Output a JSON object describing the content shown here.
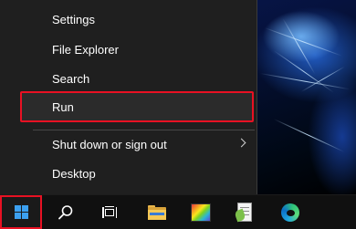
{
  "menu": {
    "items": [
      {
        "label": "Settings"
      },
      {
        "label": "File Explorer"
      },
      {
        "label": "Search"
      },
      {
        "label": "Run"
      },
      {
        "label": "Shut down or sign out"
      },
      {
        "label": "Desktop"
      }
    ],
    "highlighted_item": "Run",
    "highlight_color": "#e81123"
  },
  "taskbar": {
    "icons": [
      {
        "name": "windows-start-icon",
        "color": "#3ca0f0"
      },
      {
        "name": "search-icon"
      },
      {
        "name": "task-view-icon"
      },
      {
        "name": "file-explorer-icon"
      },
      {
        "name": "paint-app-icon"
      },
      {
        "name": "notepad-plus-plus-icon"
      },
      {
        "name": "edge-browser-icon"
      }
    ]
  },
  "colors": {
    "menu_background": "#1f1f1f",
    "taskbar_background": "#101010",
    "text": "#ffffff"
  }
}
